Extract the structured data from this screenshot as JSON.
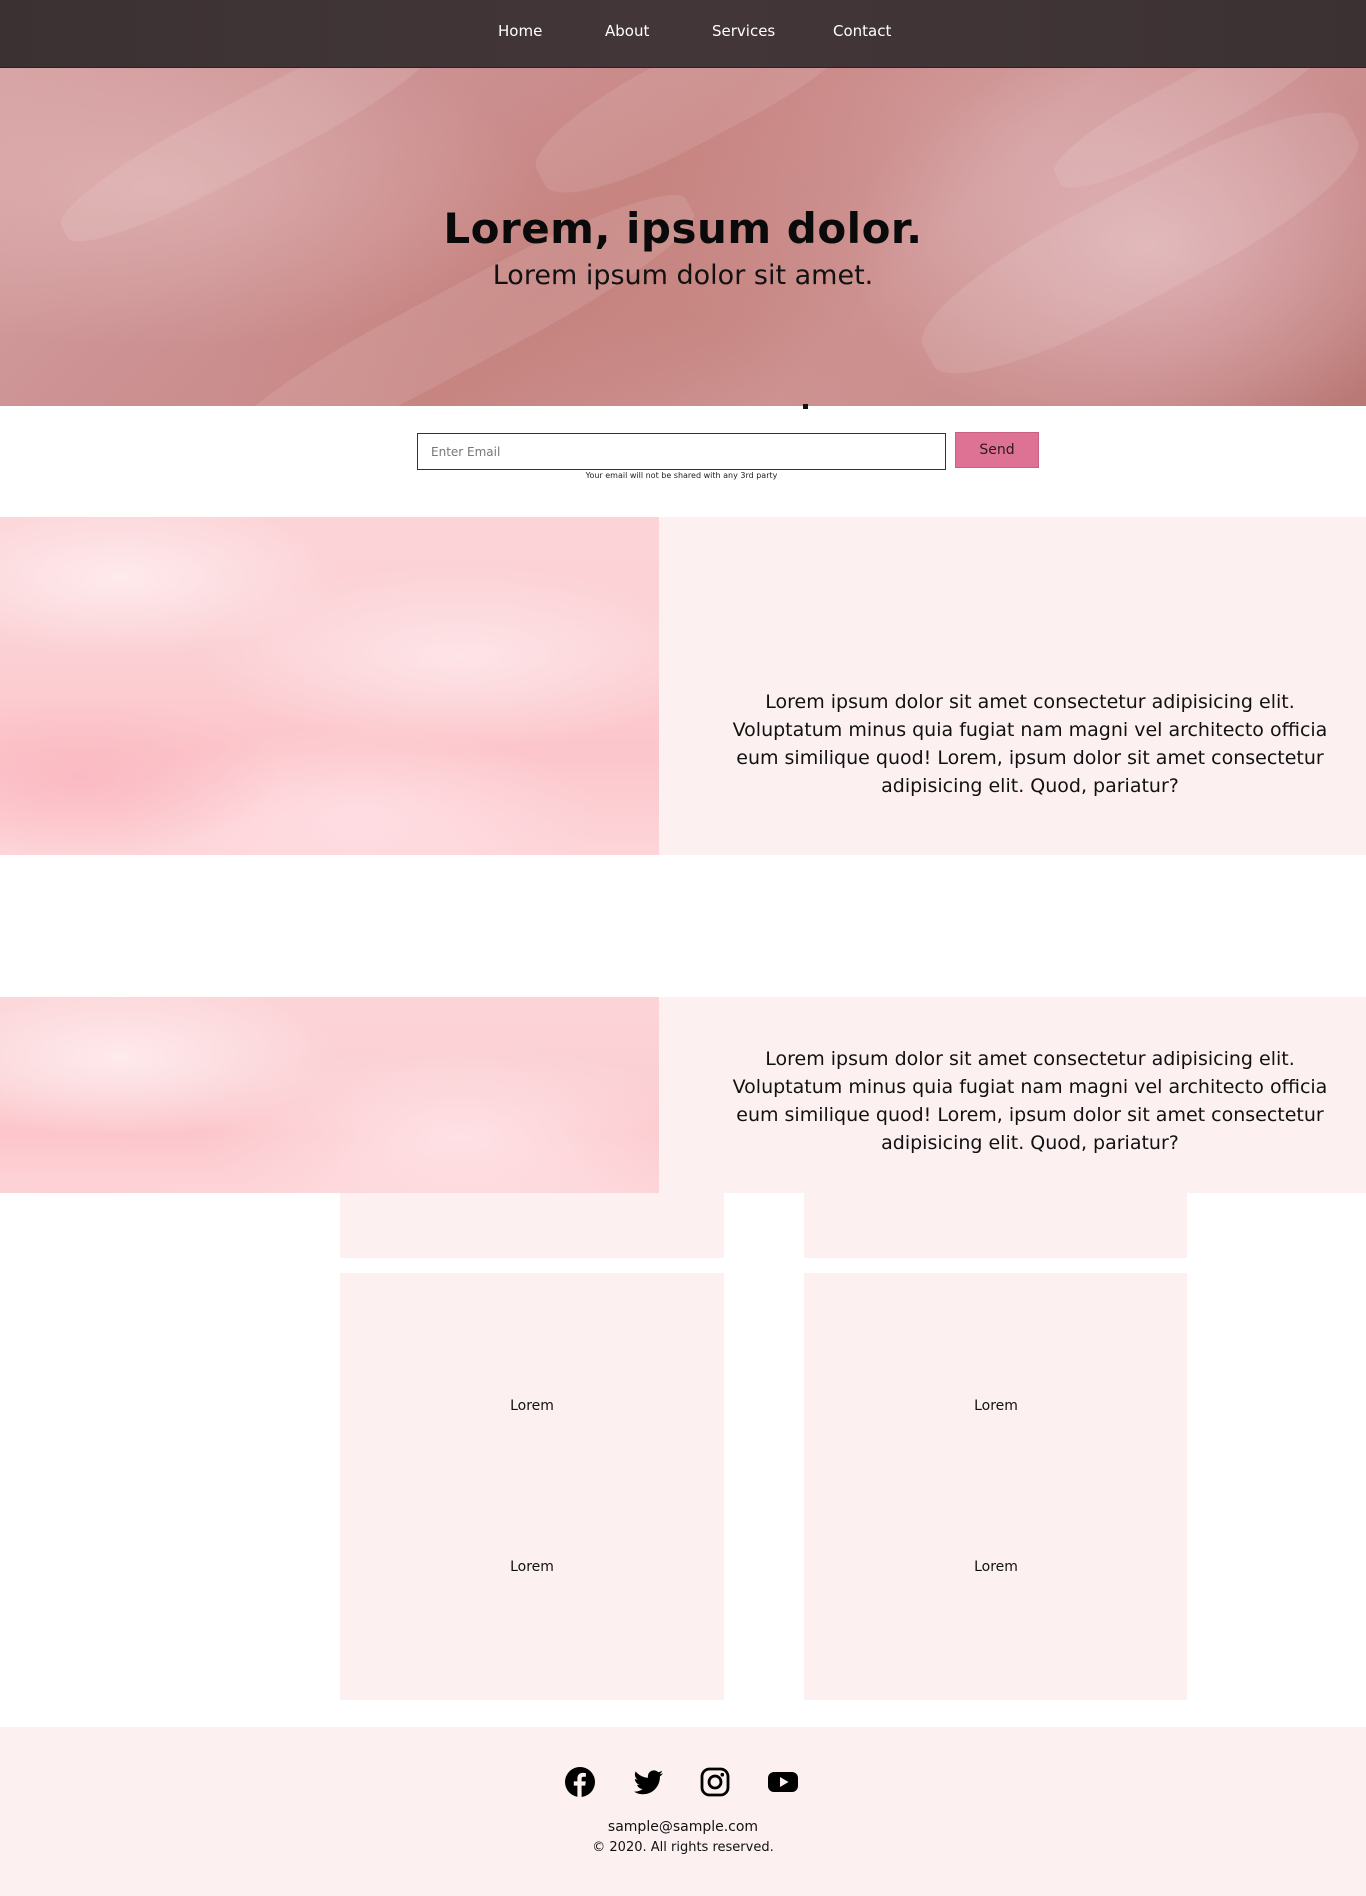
{
  "nav": {
    "items": [
      {
        "label": "Home"
      },
      {
        "label": "About"
      },
      {
        "label": "Services"
      },
      {
        "label": "Contact"
      }
    ]
  },
  "hero": {
    "title": "Lorem, ipsum dolor.",
    "subtitle": "Lorem ipsum dolor sit amet."
  },
  "newsletter": {
    "placeholder": "Enter Email",
    "button_label": "Send",
    "note": "Your email will not be shared with any 3rd party"
  },
  "features": [
    {
      "text": "Lorem ipsum dolor sit amet consectetur adipisicing elit. Voluptatum minus quia fugiat nam magni vel architecto officia eum similique quod! Lorem, ipsum dolor sit amet consectetur adipisicing elit. Quod, pariatur?"
    },
    {
      "text": "Lorem ipsum dolor sit amet consectetur adipisicing elit. Voluptatum minus quia fugiat nam magni vel architecto officia eum similique quod! Lorem, ipsum dolor sit amet consectetur adipisicing elit. Quod, pariatur?"
    }
  ],
  "cards": [
    {
      "label": "Lorem"
    },
    {
      "label": "Lorem"
    },
    {
      "label": "Lorem"
    },
    {
      "label": "Lorem"
    }
  ],
  "footer": {
    "social_icons": [
      "facebook-icon",
      "twitter-icon",
      "instagram-icon",
      "youtube-icon"
    ],
    "email": "sample@sample.com",
    "copyright": "© 2020. All rights reserved."
  },
  "colors": {
    "nav_bg": "#3d3234",
    "accent": "#dd7295",
    "panel_bg": "#fdf0f1"
  }
}
